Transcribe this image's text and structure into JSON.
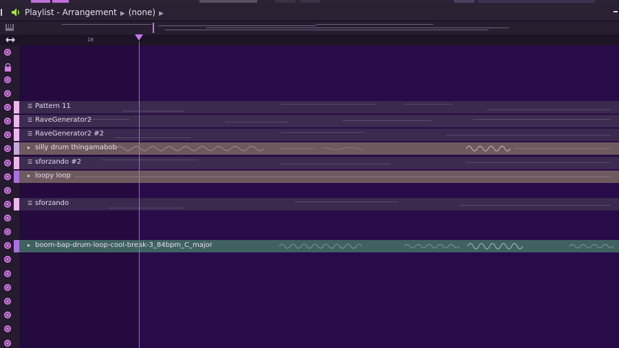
{
  "window": {
    "title": "Playlist - Arrangement",
    "pattern_selector": "(none)",
    "accent_color": "#9eea3c"
  },
  "ruler": {
    "bar_label": "18"
  },
  "icons": {
    "speaker": "speaker-icon",
    "arrows": "horizontal-arrows-icon",
    "lock": "lock-icon",
    "snap": "snap-icon",
    "minimize": "minimize-icon"
  },
  "tracks": [
    {
      "name": "",
      "clip": null
    },
    {
      "name": "",
      "clip": null
    },
    {
      "name": "",
      "clip": null
    },
    {
      "name": "",
      "clip": null
    },
    {
      "name": "",
      "clip": {
        "label": "Pattern 11",
        "kind": "pattern",
        "color": "#3a2a4e"
      }
    },
    {
      "name": "",
      "clip": {
        "label": "RaveGenerator2",
        "kind": "pattern",
        "color": "#3c2c50"
      }
    },
    {
      "name": "",
      "clip": {
        "label": "RaveGenerator2 #2",
        "kind": "pattern",
        "color": "#3a2a4e"
      }
    },
    {
      "name": "",
      "clip": {
        "label": "silly drum thingamabob",
        "kind": "audio",
        "color": "#6e5a5e"
      }
    },
    {
      "name": "",
      "clip": {
        "label": "sforzando #2",
        "kind": "pattern",
        "color": "#3c2c50"
      }
    },
    {
      "name": "",
      "clip": {
        "label": "loopy loop",
        "kind": "audio",
        "color": "#6e5a5e"
      }
    },
    {
      "name": "",
      "clip": null
    },
    {
      "name": "",
      "clip": {
        "label": "sforzando",
        "kind": "pattern",
        "color": "#3a2a4e"
      }
    },
    {
      "name": "",
      "clip": null
    },
    {
      "name": "",
      "clip": null
    },
    {
      "name": "",
      "clip": {
        "label": "boom-bap-drum-loop-cool-break-3_84bpm_C_major",
        "kind": "audio",
        "color": "#3f6260"
      }
    },
    {
      "name": "",
      "clip": null
    },
    {
      "name": "",
      "clip": null
    },
    {
      "name": "",
      "clip": null
    },
    {
      "name": "",
      "clip": null
    },
    {
      "name": "",
      "clip": null
    },
    {
      "name": "",
      "clip": null
    },
    {
      "name": "",
      "clip": null
    }
  ]
}
